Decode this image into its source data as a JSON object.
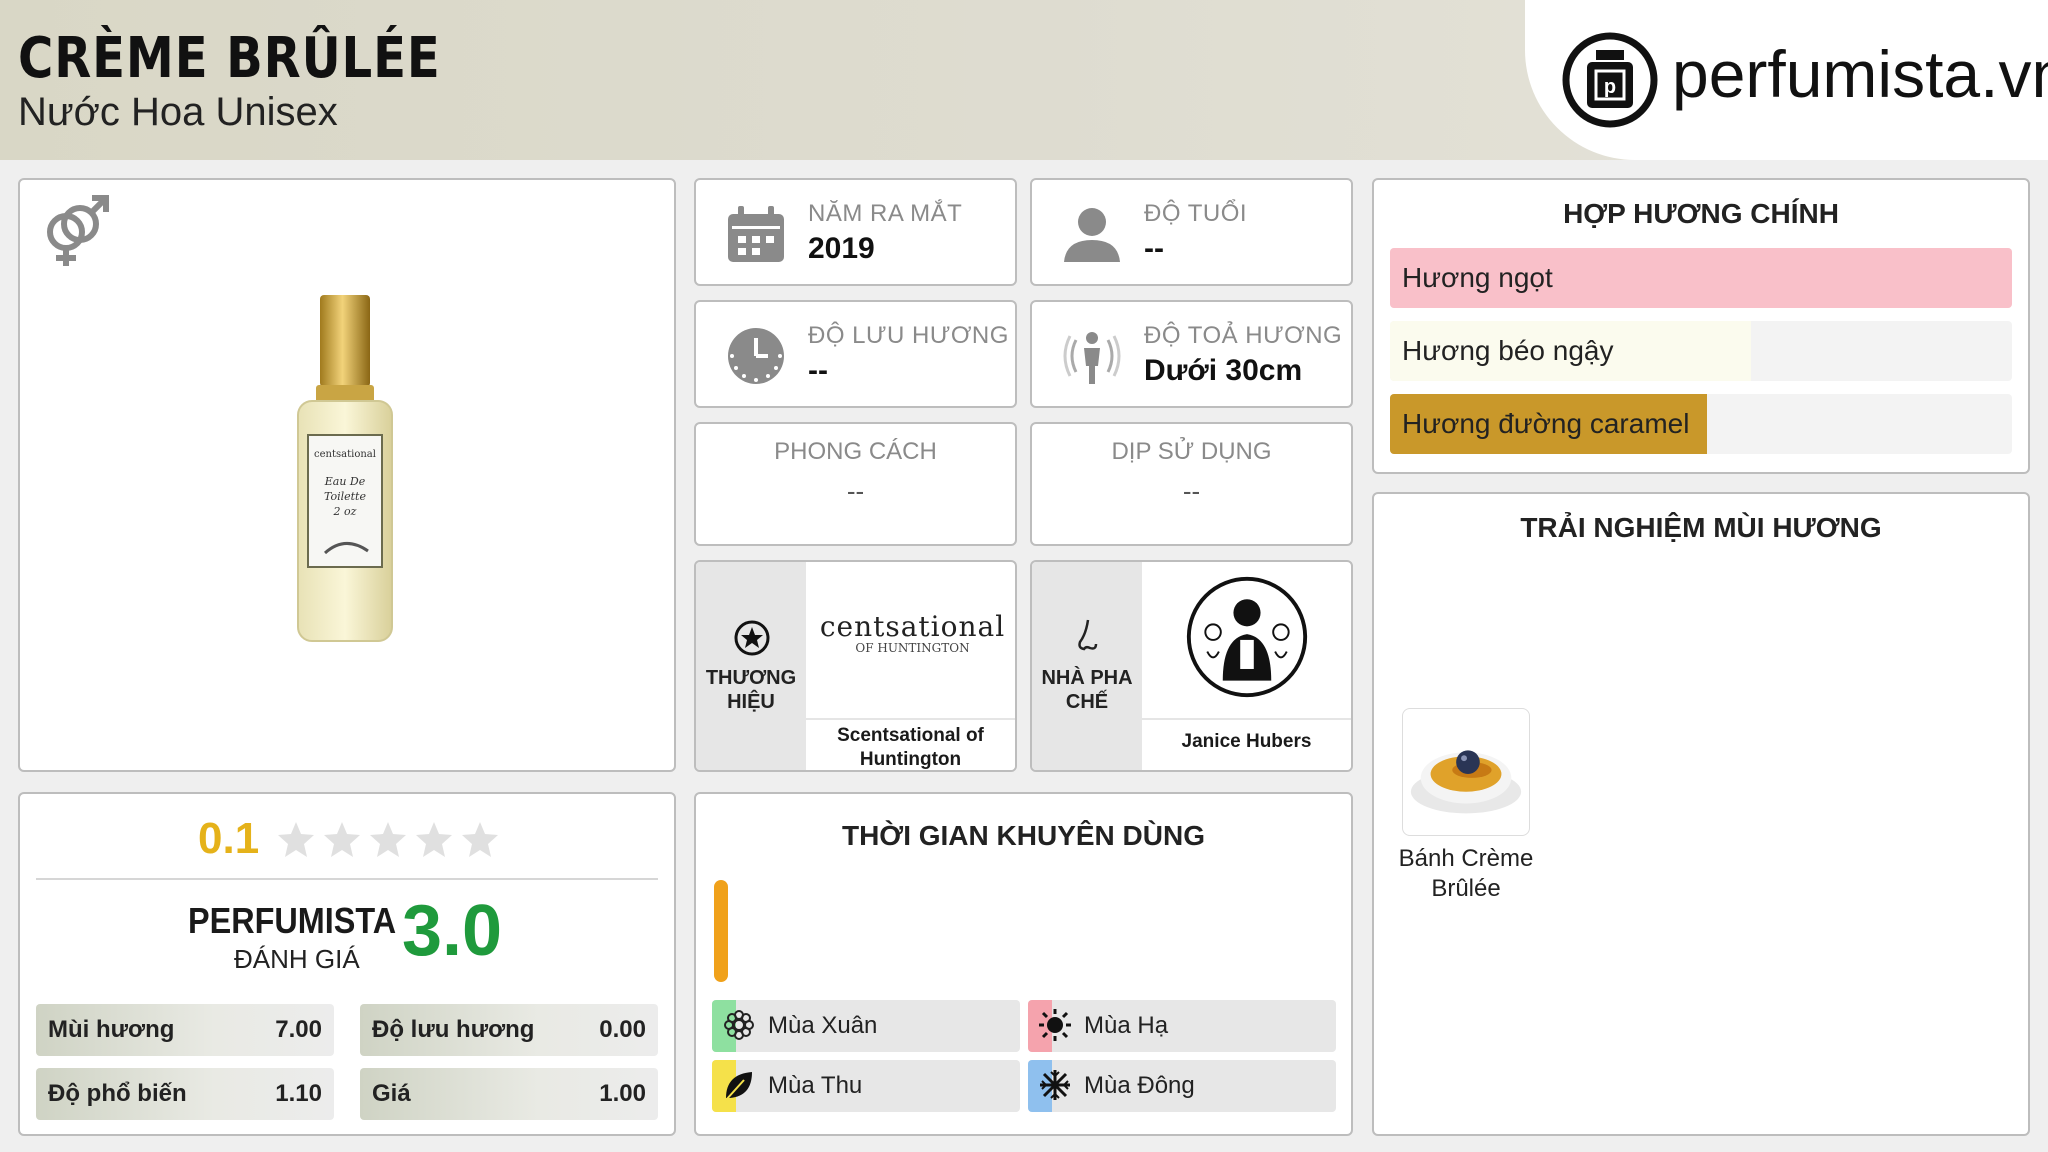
{
  "header": {
    "title": "CRÈME BRÛLÉE",
    "subtitle": "Nước Hoa Unisex",
    "logo_text": "perfumista.vn"
  },
  "product": {
    "gender_icon": "gender-unisex-icon",
    "image": "perfume-bottle-image"
  },
  "info": {
    "launch": {
      "label": "NĂM RA MẮT",
      "value": "2019",
      "icon": "calendar-icon"
    },
    "age": {
      "label": "ĐỘ TUỔI",
      "value": "--",
      "icon": "person-icon"
    },
    "longevity": {
      "label": "ĐỘ LƯU HƯƠNG",
      "value": "--",
      "icon": "clock-icon"
    },
    "sillage": {
      "label": "ĐỘ TOẢ HƯƠNG",
      "value": "Dưới 30cm",
      "icon": "sillage-icon"
    },
    "style": {
      "label": "PHONG CÁCH",
      "value": "--"
    },
    "occasion": {
      "label": "DỊP SỬ DỤNG",
      "value": "--"
    }
  },
  "brand": {
    "label_line1": "THƯƠNG",
    "label_line2": "HIỆU",
    "logo_word": "centsational",
    "logo_sub": "OF HUNTINGTON",
    "name_line1": "Scentsational of",
    "name_line2": "Huntington"
  },
  "perfumer": {
    "label_line1": "NHÀ PHA",
    "label_line2": "CHẾ",
    "name": "Janice Hubers"
  },
  "accords": {
    "title": "HỢP HƯƠNG CHÍNH",
    "items": [
      {
        "label": "Hương ngọt",
        "fraction": 1.0,
        "color": "#f9c0c9"
      },
      {
        "label": "Hương béo ngậy",
        "fraction": 0.58,
        "color": "#fbfbee"
      },
      {
        "label": "Hương đường caramel",
        "fraction": 0.51,
        "color": "#c9982a"
      }
    ]
  },
  "experience": {
    "title": "TRẢI NGHIỆM MÙI HƯƠNG",
    "note_line1": "Bánh Crème",
    "note_line2": "Brûlée"
  },
  "rating": {
    "user_score": "0.1",
    "stars_filled": 0.02,
    "stars_total": 5,
    "brand_label": "PERFUMISTA",
    "sub_label": "ĐÁNH GIÁ",
    "perfumista_score": "3.0",
    "score_color": "#1f9a3c",
    "user_score_color": "#e5b21a",
    "scores": [
      {
        "label": "Mùi hương",
        "value": "7.00"
      },
      {
        "label": "Độ lưu hương",
        "value": "0.00"
      },
      {
        "label": "Độ phổ biến",
        "value": "1.10"
      },
      {
        "label": "Giá",
        "value": "1.00"
      }
    ]
  },
  "seasons": {
    "title": "THỜI GIAN KHUYÊN DÙNG",
    "time_bar_color": "#f0a11a",
    "items": [
      {
        "label": "Mùa Xuân",
        "color": "#8ee0a0",
        "icon": "flower-icon"
      },
      {
        "label": "Mùa Hạ",
        "color": "#f5a3ad",
        "icon": "sun-icon"
      },
      {
        "label": "Mùa Thu",
        "color": "#f5e14a",
        "icon": "leaf-icon"
      },
      {
        "label": "Mùa Đông",
        "color": "#8fc0ee",
        "icon": "snowflake-icon"
      }
    ]
  }
}
